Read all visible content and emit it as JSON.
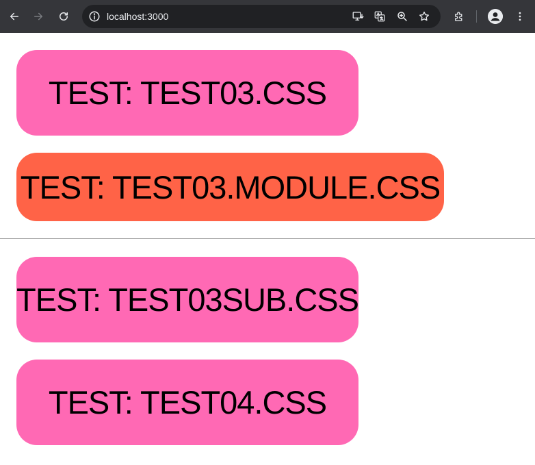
{
  "browser": {
    "url": "localhost:3000",
    "toolbar_bg": "#35363a",
    "omnibox_bg": "#202124",
    "icons": {
      "back": "arrow-left-icon",
      "forward": "arrow-right-icon",
      "reload": "reload-icon",
      "info": "info-icon",
      "install": "install-app-icon",
      "translate": "translate-icon",
      "zoom": "zoom-icon",
      "bookmark": "star-icon",
      "extensions": "puzzle-icon",
      "profile": "avatar-icon",
      "menu": "kebab-menu-icon"
    }
  },
  "page": {
    "boxes": [
      {
        "label": "TEST: TEST03.CSS",
        "color": "#ff69b4"
      },
      {
        "label": "TEST: TEST03.MODULE.CSS",
        "color": "#ff6347"
      },
      {
        "label": "TEST: TEST03SUB.CSS",
        "color": "#ff69b4"
      },
      {
        "label": "TEST: TEST04.CSS",
        "color": "#ff69b4"
      }
    ]
  }
}
